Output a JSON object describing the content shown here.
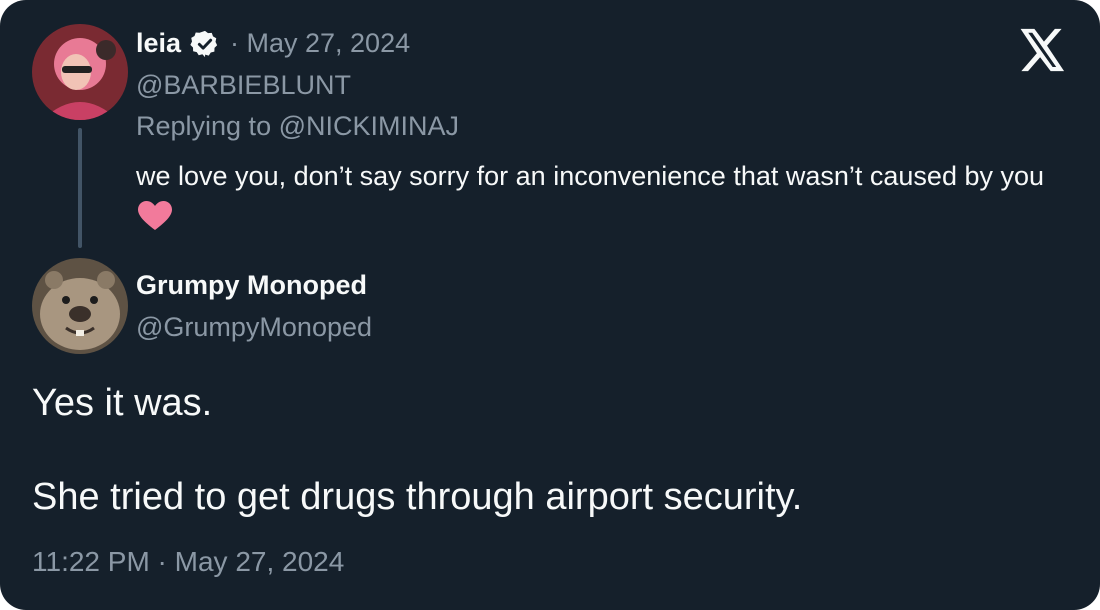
{
  "reply_tweet": {
    "display_name": "leia",
    "verified": true,
    "date": "· May 27, 2024",
    "handle": "@BARBIEBLUNT",
    "replying_to_prefix": "Replying to ",
    "replying_to_handle": "@NICKIMINAJ",
    "body": "we love you, don’t say sorry for an inconvenience that wasn’t caused by you",
    "emoji": "pink-heart-icon"
  },
  "main_tweet": {
    "display_name": "Grumpy Monoped",
    "handle": "@GrumpyMonoped",
    "line1": "Yes it was.",
    "line2": "She tried to get drugs through airport security.",
    "timestamp": "11:22 PM · May 27, 2024"
  },
  "colors": {
    "background": "#15202b",
    "primary_text": "#f7f9f9",
    "secondary_text": "#8b98a5",
    "thread_line": "#425466",
    "heart": "#f27a9b"
  },
  "icons": {
    "platform_logo": "x-logo-icon",
    "verified_badge": "verified-badge-icon"
  }
}
